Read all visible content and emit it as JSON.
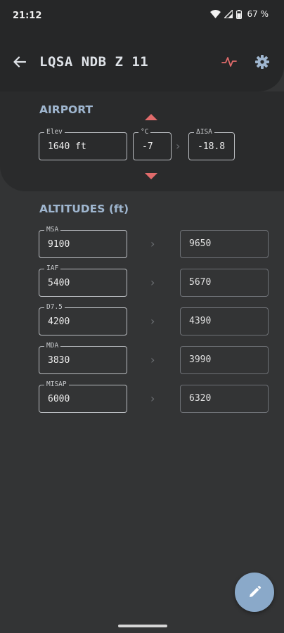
{
  "status_bar": {
    "time": "21:12",
    "battery": "67 %"
  },
  "header": {
    "title": "LQSA NDB Z 11"
  },
  "airport": {
    "section_title": "AIRPORT",
    "elev": {
      "label": "Elev",
      "value": "1640 ft"
    },
    "temp": {
      "label": "°C",
      "value": "-7"
    },
    "isa": {
      "label": "ΔISA",
      "value": "-18.8"
    }
  },
  "altitudes": {
    "section_title": "ALTITUDES (ft)",
    "rows": [
      {
        "label": "MSA",
        "value": "9100",
        "corrected": "9650"
      },
      {
        "label": "IAF",
        "value": "5400",
        "corrected": "5670"
      },
      {
        "label": "D7.5",
        "value": "4200",
        "corrected": "4390"
      },
      {
        "label": "MDA",
        "value": "3830",
        "corrected": "3990"
      },
      {
        "label": "MISAP",
        "value": "6000",
        "corrected": "6320"
      }
    ]
  },
  "icons": {
    "back": "arrow-back-icon",
    "activity": "pulse-icon",
    "settings": "gear-icon",
    "increase": "triangle-up-icon",
    "decrease": "triangle-down-icon",
    "edit": "pencil-icon"
  },
  "colors": {
    "accent_blue": "#9fb6cf",
    "accent_red": "#e06b6b",
    "fab": "#8aa9c9",
    "background": "#333435"
  }
}
